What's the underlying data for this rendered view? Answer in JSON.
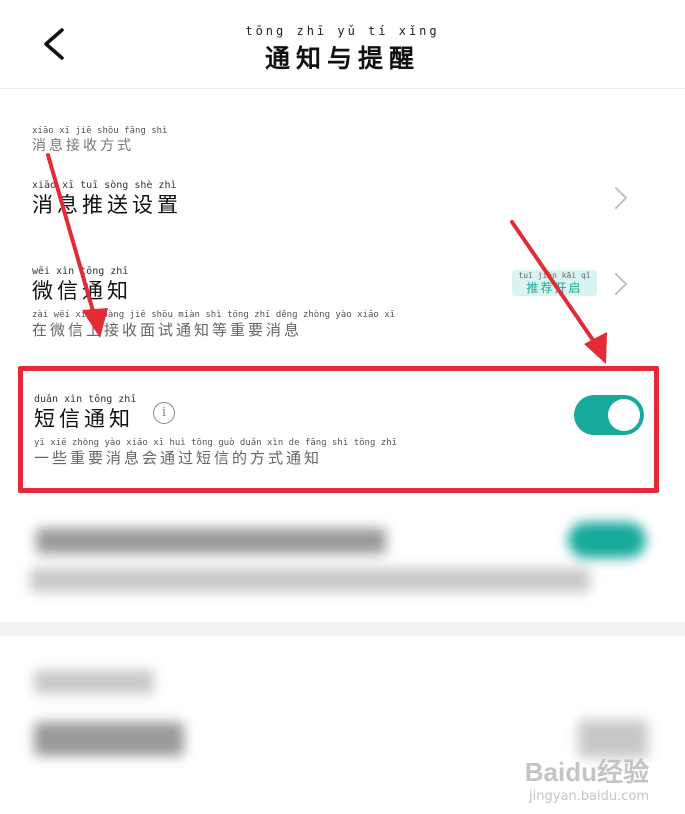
{
  "header": {
    "title_pinyin": "tōng zhī yǔ tí xǐng",
    "title": "通知与提醒"
  },
  "section_label": {
    "pinyin": "xiāo xī jiē shōu fāng shì",
    "text": "消息接收方式"
  },
  "push_settings": {
    "pinyin": "xiāo xī tuī sòng shè zhì",
    "label": "消息推送设置"
  },
  "wechat_notify": {
    "pinyin": "wēi xìn tōng zhī",
    "label": "微信通知",
    "desc_pinyin": "zài wēi xìn shàng jiē shōu miàn shì tōng zhī děng zhòng yào xiāo xī",
    "desc": "在微信上接收面试通知等重要消息",
    "badge_pinyin": "tuī jiàn kāi qǐ",
    "badge": "推荐开启"
  },
  "sms_notify": {
    "pinyin": "duǎn xìn tōng zhī",
    "label": "短信通知",
    "info_icon": "i",
    "desc_pinyin": "yī xiē zhòng yào xiāo xī huì tōng guò duǎn xìn de fāng shì tōng zhī",
    "desc": "一些重要消息会通过短信的方式通知",
    "enabled": true
  },
  "watermark": {
    "brand": "Baidu经验",
    "site": "jingyan.baidu.com"
  },
  "colors": {
    "accent": "#17a99b",
    "highlight": "#e32b35",
    "arrow": "#e32b35"
  }
}
